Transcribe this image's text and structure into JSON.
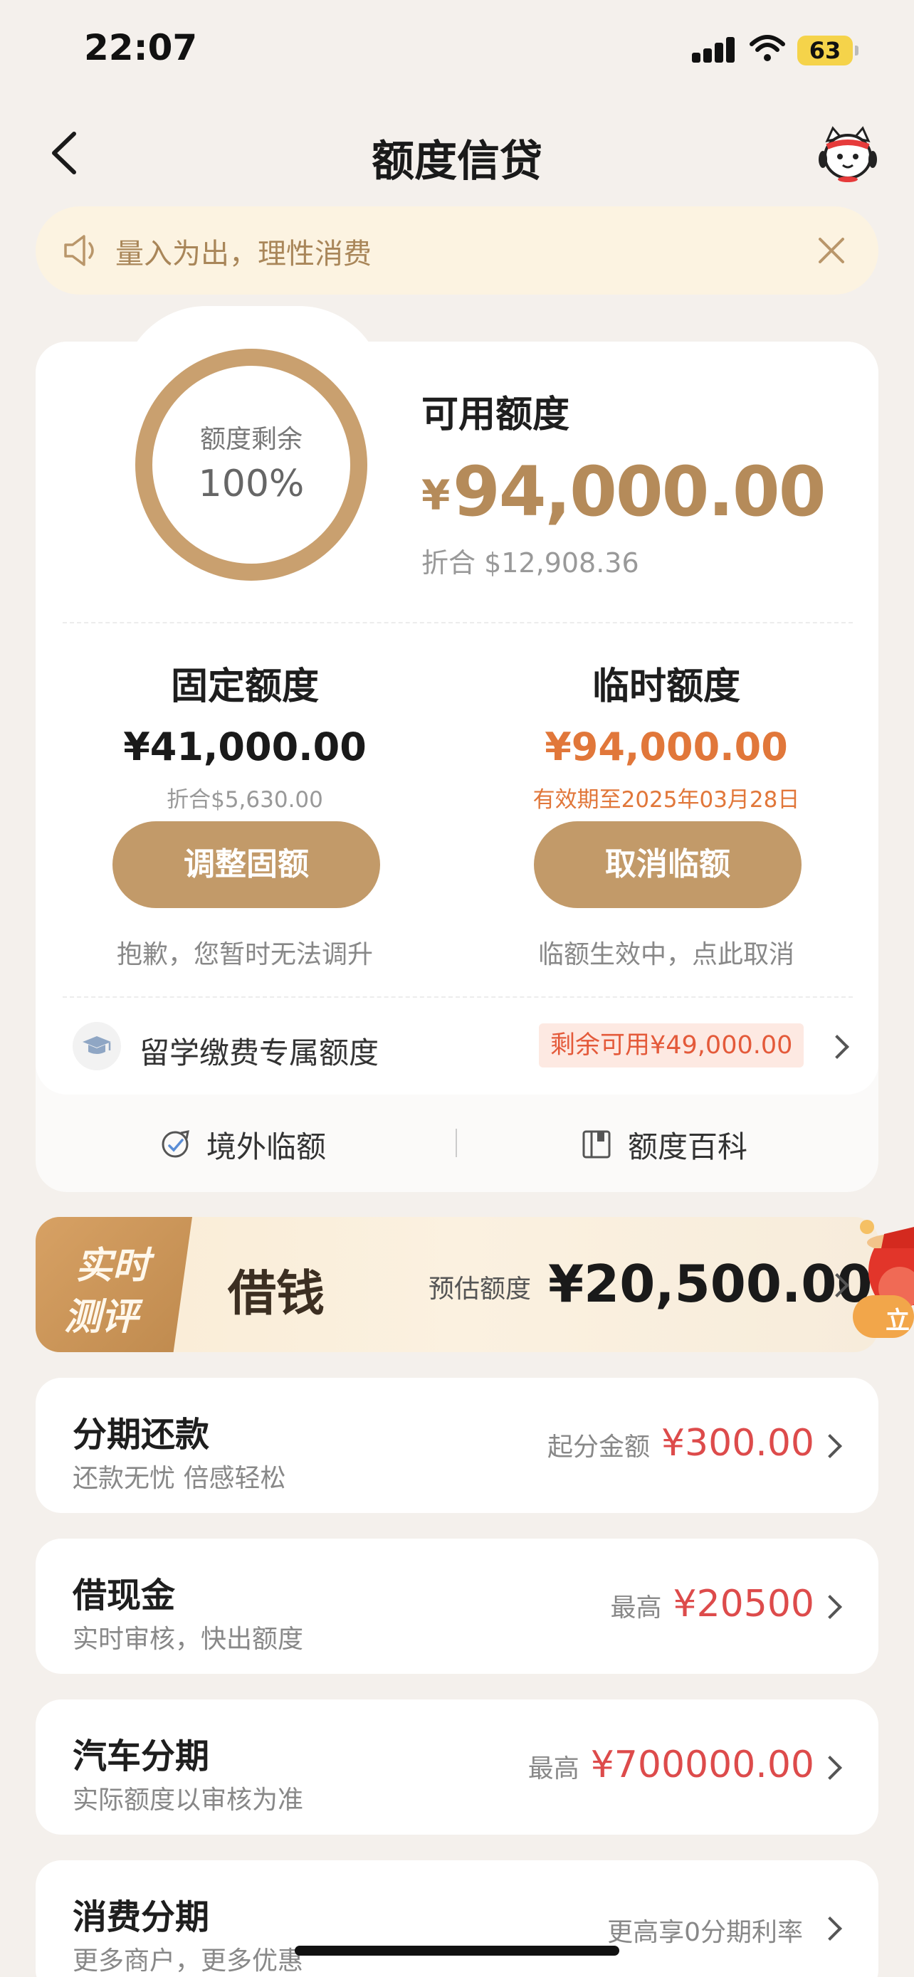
{
  "status_bar": {
    "time": "22:07",
    "battery": "63"
  },
  "nav": {
    "title": "额度信贷"
  },
  "notice": {
    "text": "量入为出，理性消费"
  },
  "credit": {
    "ring_label": "额度剩余",
    "ring_value": "100%",
    "remaining_fraction": 1.0,
    "available_label": "可用额度",
    "available_currency": "¥",
    "available_amount": "94,000.00",
    "available_usd": "折合 $12,908.36",
    "fixed": {
      "title": "固定额度",
      "amount": "¥41,000.00",
      "sub": "折合$5,630.00",
      "button": "调整固额",
      "note": "抱歉，您暂时无法调升"
    },
    "temp": {
      "title": "临时额度",
      "amount": "¥94,000.00",
      "sub": "有效期至2025年03月28日",
      "button": "取消临额",
      "note": "临额生效中，点此取消"
    },
    "study": {
      "label": "留学缴费专属额度",
      "badge": "剩余可用¥49,000.00"
    },
    "links": {
      "overseas": "境外临额",
      "wiki": "额度百科"
    }
  },
  "promo": {
    "tag_line1": "实时",
    "tag_line2": "测评",
    "title": "借钱",
    "est_label": "预估额度",
    "amount": "¥20,500.00",
    "side_label": "立"
  },
  "products": [
    {
      "title": "分期还款",
      "sub": "还款无忧 倍感轻松",
      "right_label": "起分金额",
      "right_value": "¥300.00"
    },
    {
      "title": "借现金",
      "sub": "实时审核，快出额度",
      "right_label": "最高",
      "right_value": "¥20500"
    },
    {
      "title": "汽车分期",
      "sub": "实际额度以审核为准",
      "right_label": "最高",
      "right_value": "¥700000.00"
    },
    {
      "title": "消费分期",
      "sub": "更多商户，更多优惠",
      "right_label": "更高享0分期利率",
      "right_value": ""
    }
  ],
  "colors": {
    "accent_gold": "#c29a69",
    "temp_orange": "#e1773a",
    "price_red": "#dd4b4b",
    "background": "#f4f0ec"
  }
}
